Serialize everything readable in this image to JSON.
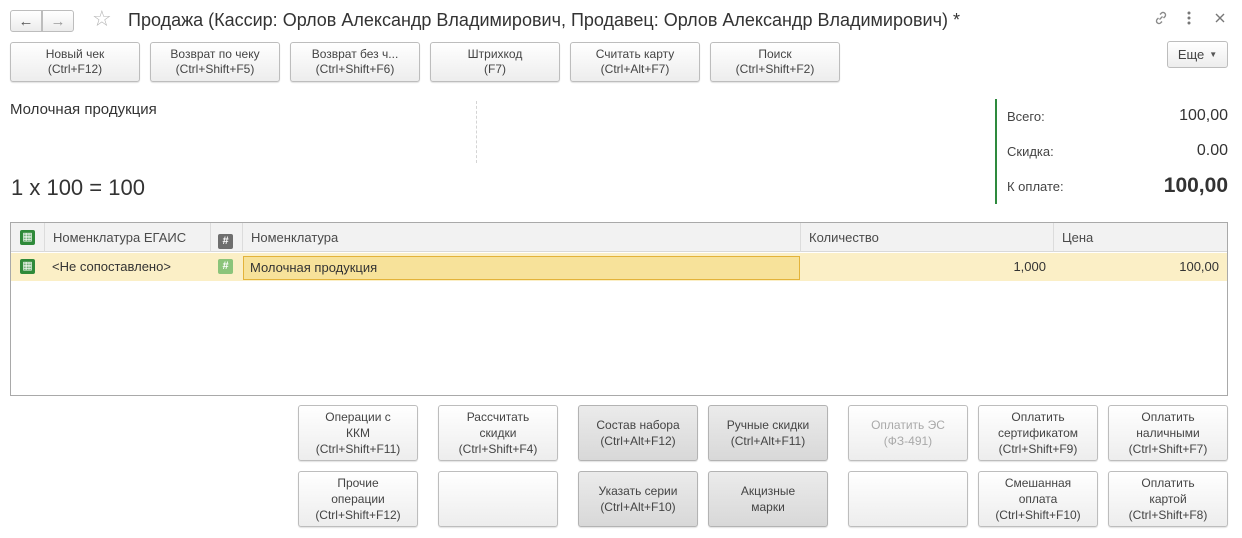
{
  "window": {
    "title": "Продажа (Кассир: Орлов Александр Владимирович, Продавец: Орлов Александр Владимирович) *"
  },
  "toolbar": {
    "buttons": [
      {
        "label": "Новый чек",
        "hotkey": "(Ctrl+F12)"
      },
      {
        "label": "Возврат по чеку",
        "hotkey": "(Ctrl+Shift+F5)"
      },
      {
        "label": "Возврат без ч...",
        "hotkey": "(Ctrl+Shift+F6)"
      },
      {
        "label": "Штрихкод",
        "hotkey": "(F7)"
      },
      {
        "label": "Считать карту",
        "hotkey": "(Ctrl+Alt+F7)"
      },
      {
        "label": "Поиск",
        "hotkey": "(Ctrl+Shift+F2)"
      }
    ],
    "more_label": "Еще"
  },
  "info": {
    "product_name": "Молочная продукция",
    "formula": "1 x 100 = 100"
  },
  "summary": {
    "total_label": "Всего:",
    "total_value": "100,00",
    "discount_label": "Скидка:",
    "discount_value": "0.00",
    "to_pay_label": "К оплате:",
    "to_pay_value": "100,00"
  },
  "table": {
    "headers": {
      "egais": "Номенклатура ЕГАИС",
      "nomenclature": "Номенклатура",
      "quantity": "Количество",
      "price": "Цена"
    },
    "rows": [
      {
        "egais": "<Не сопоставлено>",
        "nomenclature": "Молочная продукция",
        "quantity": "1,000",
        "price": "100,00"
      }
    ]
  },
  "actions": {
    "row1": [
      {
        "lines": [
          "Операции с",
          "ККМ",
          "(Ctrl+Shift+F11)"
        ]
      },
      {
        "lines": [
          "Рассчитать",
          "скидки",
          "(Ctrl+Shift+F4)"
        ]
      },
      {
        "lines": [
          "Состав набора",
          "(Ctrl+Alt+F12)"
        ]
      },
      {
        "lines": [
          "Ручные скидки",
          "(Ctrl+Alt+F11)"
        ]
      },
      {
        "lines": [
          "Оплатить ЭС",
          "(ФЗ-491)"
        ]
      },
      {
        "lines": [
          "Оплатить",
          "сертификатом",
          "(Ctrl+Shift+F9)"
        ]
      },
      {
        "lines": [
          "Оплатить",
          "наличными",
          "(Ctrl+Shift+F7)"
        ]
      }
    ],
    "row2": [
      {
        "lines": [
          "Прочие",
          "операции",
          "(Ctrl+Shift+F12)"
        ]
      },
      {
        "lines": []
      },
      {
        "lines": [
          "Указать серии",
          "(Ctrl+Alt+F10)"
        ]
      },
      {
        "lines": [
          "Акцизные",
          "марки"
        ]
      },
      {
        "lines": []
      },
      {
        "lines": [
          "Смешанная",
          "оплата",
          "(Ctrl+Shift+F10)"
        ]
      },
      {
        "lines": [
          "Оплатить",
          "картой",
          "(Ctrl+Shift+F8)"
        ]
      }
    ]
  }
}
